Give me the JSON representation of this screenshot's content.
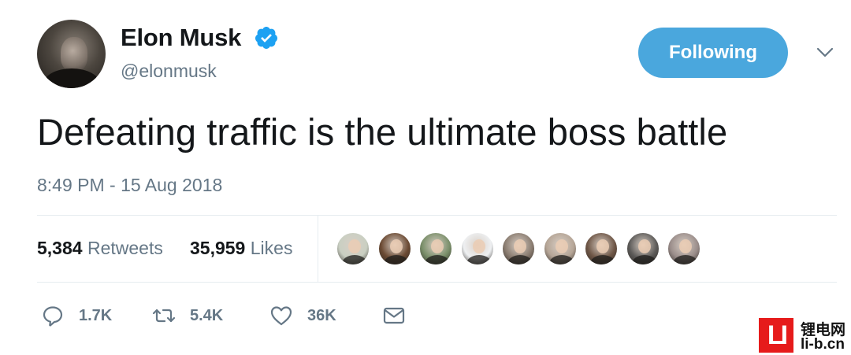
{
  "author": {
    "name": "Elon Musk",
    "handle": "@elonmusk",
    "verified": true
  },
  "follow_button": {
    "label": "Following",
    "color": "#4aa7dd"
  },
  "tweet": {
    "text": "Defeating traffic is the ultimate boss battle",
    "timestamp": "8:49 PM - 15 Aug 2018"
  },
  "stats": {
    "retweets_count": "5,384",
    "retweets_label": "Retweets",
    "likes_count": "35,959",
    "likes_label": "Likes"
  },
  "liker_avatars": [
    {
      "name": "liker-1",
      "color": "#c9cfc2"
    },
    {
      "name": "liker-2",
      "color": "#6b4a33"
    },
    {
      "name": "liker-3",
      "color": "#7a8f6a"
    },
    {
      "name": "liker-4",
      "color": "#eef0f2"
    },
    {
      "name": "liker-5",
      "color": "#8a7c70"
    },
    {
      "name": "liker-6",
      "color": "#b5a596"
    },
    {
      "name": "liker-7",
      "color": "#6e5646"
    },
    {
      "name": "liker-8",
      "color": "#5c5a58"
    },
    {
      "name": "liker-9",
      "color": "#9a8d8a"
    }
  ],
  "actions": {
    "reply_count": "1.7K",
    "retweet_count": "5.4K",
    "like_count": "36K"
  },
  "watermark": {
    "logo": "LI",
    "chinese": "锂电网",
    "domain": "li-b.cn",
    "color": "#e61b1b"
  },
  "colors": {
    "text_primary": "#14171a",
    "text_secondary": "#657786",
    "verified_blue": "#1da1f2",
    "divider": "#e6ecf0"
  }
}
